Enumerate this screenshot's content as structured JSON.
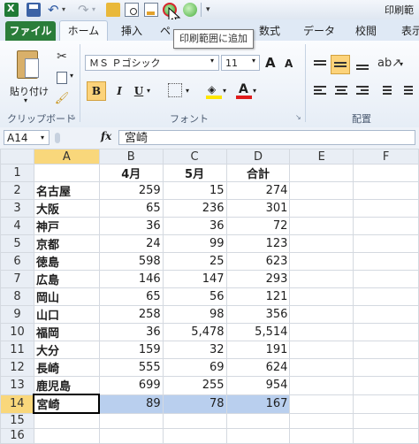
{
  "window": {
    "title_fragment": "印刷範"
  },
  "tabs": [
    {
      "label": "ファイル"
    },
    {
      "label": "ホーム"
    },
    {
      "label": "挿入"
    },
    {
      "label": "ペ"
    },
    {
      "label": "数式"
    },
    {
      "label": "データ"
    },
    {
      "label": "校閲"
    },
    {
      "label": "表示"
    }
  ],
  "tooltip": "印刷範囲に追加",
  "ribbon": {
    "clipboard": {
      "paste_label": "貼り付け",
      "group_label": "クリップボード"
    },
    "font": {
      "font_name": "ＭＳ Ｐゴシック",
      "font_size": "11",
      "grow": "A",
      "shrink": "A",
      "bold": "B",
      "italic": "I",
      "underline": "U",
      "font_color_letter": "A",
      "group_label": "フォント"
    },
    "alignment": {
      "group_label": "配置"
    }
  },
  "formula_bar": {
    "name_box": "A14",
    "fx": "fx",
    "value": "宮崎"
  },
  "columns": [
    "A",
    "B",
    "C",
    "D",
    "E",
    "F"
  ],
  "header_row": {
    "a": "",
    "b": "4月",
    "c": "5月",
    "d": "合計"
  },
  "rows": [
    {
      "n": "2",
      "a": "名古屋",
      "b": "259",
      "c": "15",
      "d": "274"
    },
    {
      "n": "3",
      "a": "大阪",
      "b": "65",
      "c": "236",
      "d": "301"
    },
    {
      "n": "4",
      "a": "神戸",
      "b": "36",
      "c": "36",
      "d": "72"
    },
    {
      "n": "5",
      "a": "京都",
      "b": "24",
      "c": "99",
      "d": "123"
    },
    {
      "n": "6",
      "a": "徳島",
      "b": "598",
      "c": "25",
      "d": "623"
    },
    {
      "n": "7",
      "a": "広島",
      "b": "146",
      "c": "147",
      "d": "293"
    },
    {
      "n": "8",
      "a": "岡山",
      "b": "65",
      "c": "56",
      "d": "121"
    },
    {
      "n": "9",
      "a": "山口",
      "b": "258",
      "c": "98",
      "d": "356"
    },
    {
      "n": "10",
      "a": "福岡",
      "b": "36",
      "c": "5,478",
      "d": "5,514"
    },
    {
      "n": "11",
      "a": "大分",
      "b": "159",
      "c": "32",
      "d": "191"
    },
    {
      "n": "12",
      "a": "長崎",
      "b": "555",
      "c": "69",
      "d": "624"
    },
    {
      "n": "13",
      "a": "鹿児島",
      "b": "699",
      "c": "255",
      "d": "954"
    },
    {
      "n": "14",
      "a": "宮崎",
      "b": "89",
      "c": "78",
      "d": "167"
    },
    {
      "n": "15",
      "a": "",
      "b": "",
      "c": "",
      "d": ""
    },
    {
      "n": "16",
      "a": "",
      "b": "",
      "c": "",
      "d": ""
    }
  ],
  "colors": {
    "file_tab": "#2a7d3a",
    "selection": "#b9cfee",
    "active_header": "#f9d77b"
  }
}
